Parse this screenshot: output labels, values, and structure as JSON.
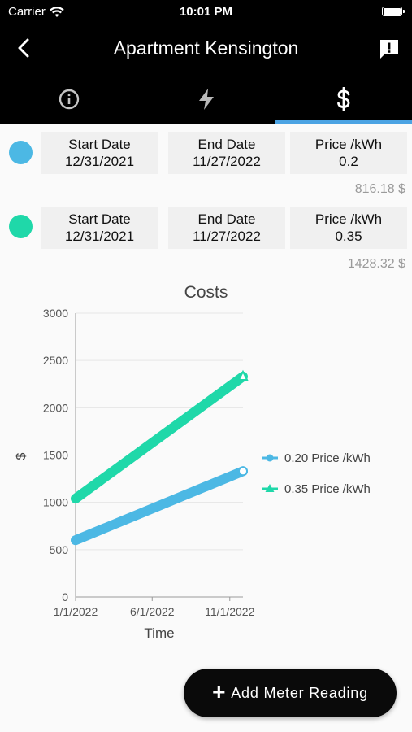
{
  "status_bar": {
    "carrier": "Carrier",
    "time": "10:01 PM"
  },
  "app_bar": {
    "title": "Apartment Kensington"
  },
  "tabs": [
    {
      "icon": "info-icon"
    },
    {
      "icon": "lightning-icon"
    },
    {
      "icon": "dollar-icon",
      "selected": true
    }
  ],
  "prices": [
    {
      "color": "#4cb8e4",
      "start_label": "Start Date",
      "start": "12/31/2021",
      "end_label": "End Date",
      "end": "11/27/2022",
      "price_label": "Price /kWh",
      "price": "0.2",
      "total": "816.18 $"
    },
    {
      "color": "#1fd8a9",
      "start_label": "Start Date",
      "start": "12/31/2021",
      "end_label": "End Date",
      "end": "11/27/2022",
      "price_label": "Price /kWh",
      "price": "0.35",
      "total": "1428.32 $"
    }
  ],
  "chart_data": {
    "type": "line",
    "title": "Costs",
    "xlabel": "Time",
    "ylabel": "$",
    "x_ticks": [
      "1/1/2022",
      "6/1/2022",
      "11/1/2022"
    ],
    "y_ticks": [
      "0",
      "500",
      "1000",
      "1500",
      "2000",
      "2500",
      "3000"
    ],
    "ylim": [
      0,
      3000
    ],
    "xlim": [
      "1/1/2022",
      "11/27/2022"
    ],
    "legend_position": "right",
    "series": [
      {
        "name": "0.20 Price /kWh",
        "color": "#4cb8e4",
        "marker": "circle",
        "x": [
          "1/1/2022",
          "11/27/2022"
        ],
        "values": [
          600,
          1330
        ]
      },
      {
        "name": "0.35 Price /kWh",
        "color": "#1fd8a9",
        "marker": "triangle",
        "x": [
          "1/1/2022",
          "11/27/2022"
        ],
        "values": [
          1040,
          2330
        ]
      }
    ]
  },
  "fab": {
    "label": "Add Meter Reading",
    "icon": "plus-icon"
  }
}
